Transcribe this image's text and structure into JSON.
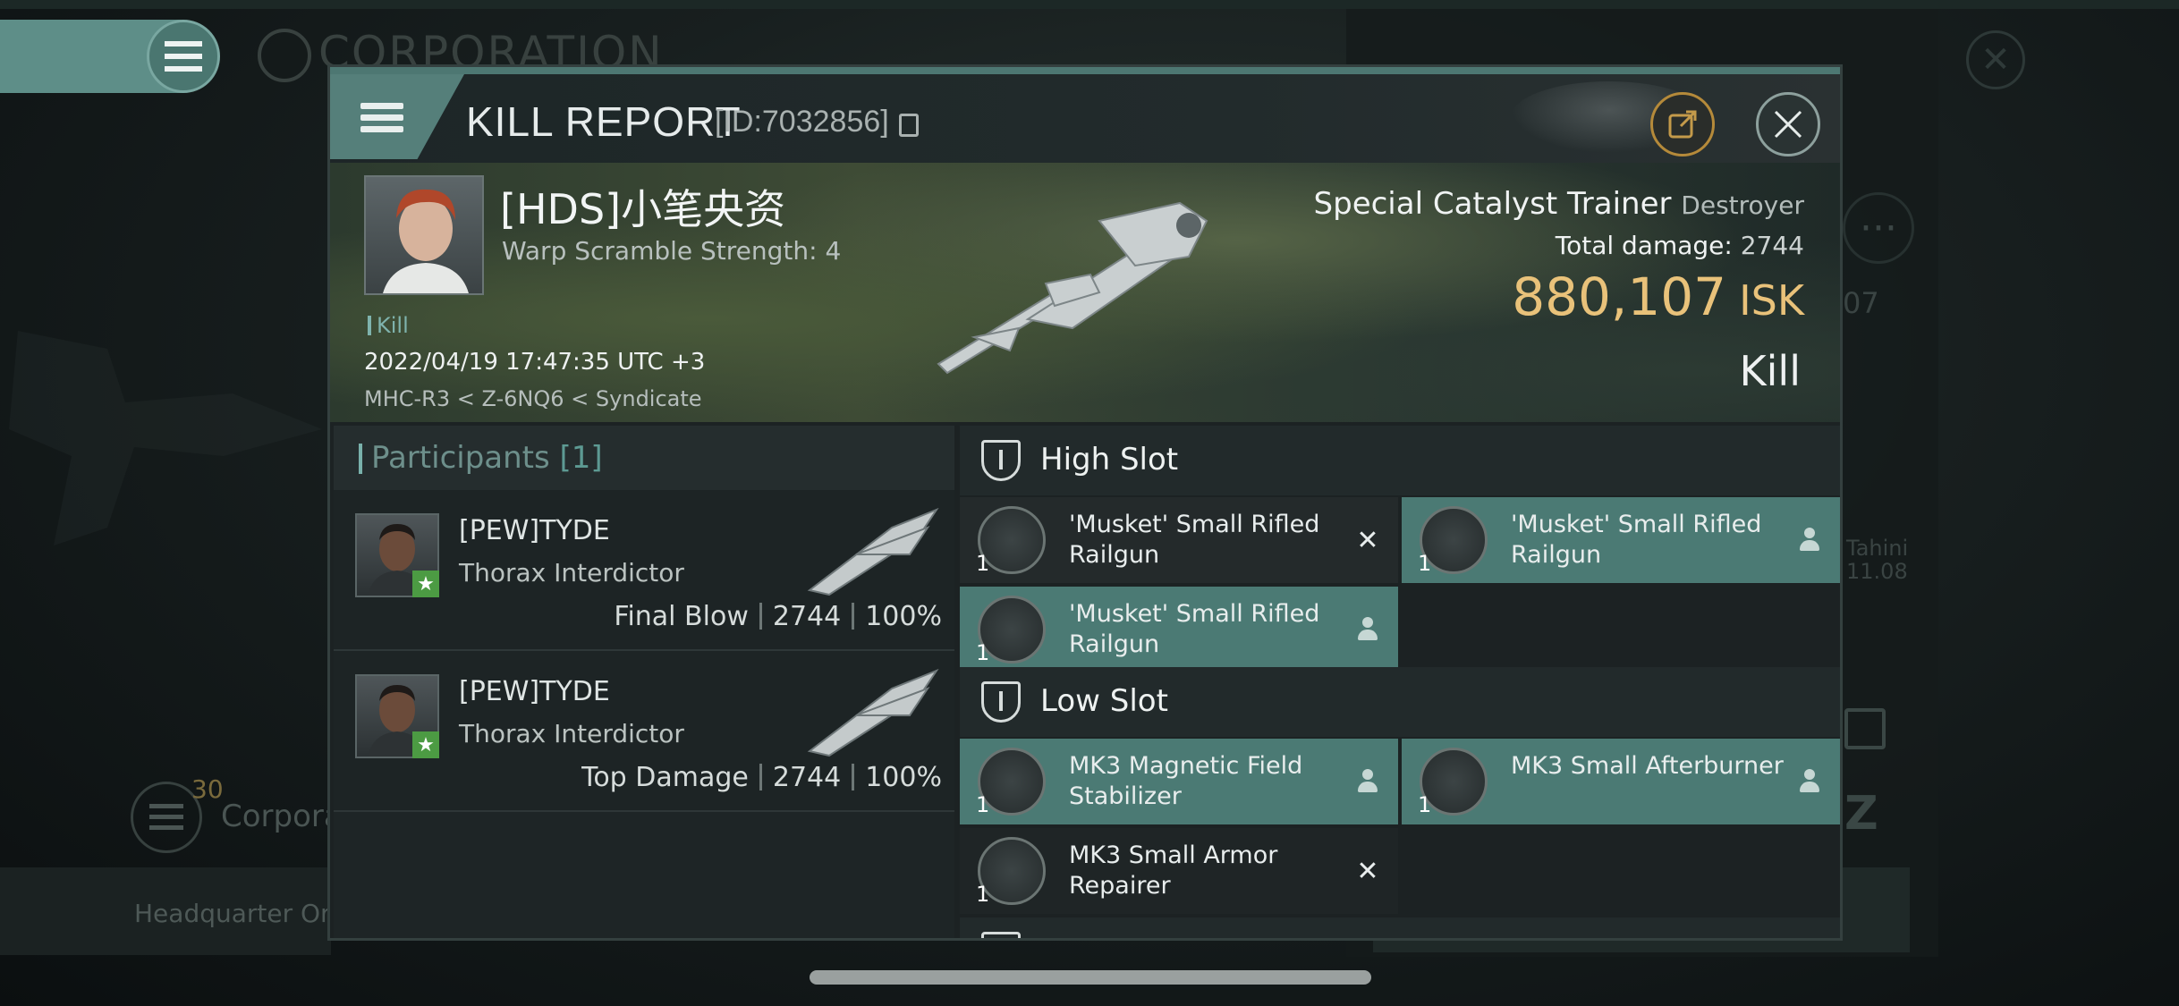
{
  "background": {
    "corp_title": "CORPORATION",
    "corp_button_count": "30",
    "corp_button_label": "Corpora",
    "hq_label": "Headquarter Orvc",
    "right_label_1": "Tahini",
    "right_label_2": "11.08",
    "right_number": "07",
    "dots": "···"
  },
  "header": {
    "title": "KILL REPORT",
    "report_id": "[ID:7032856]"
  },
  "victim": {
    "name": "[HDS]小笔央资",
    "subtitle": "Warp Scramble Strength: 4",
    "tag": "Kill",
    "datetime": "2022/04/19 17:47:35 UTC +3",
    "location": "MHC-R3 < Z-6NQ6 < Syndicate"
  },
  "ship": {
    "name": "Special Catalyst Trainer",
    "class": "Destroyer",
    "total_damage_label": "Total damage:",
    "total_damage_value": "2744",
    "isk_value": "880,107",
    "isk_unit": "ISK",
    "result": "Kill"
  },
  "participants": {
    "label": "Participants",
    "count": "[1]",
    "rows": [
      {
        "name": "[PEW]TYDE",
        "ship": "Thorax Interdictor",
        "role": "Final Blow",
        "damage": "2744",
        "percent": "100%"
      },
      {
        "name": "[PEW]TYDE",
        "ship": "Thorax Interdictor",
        "role": "Top Damage",
        "damage": "2744",
        "percent": "100%"
      }
    ]
  },
  "fittings": {
    "high_slot_label": "High Slot",
    "low_slot_label": "Low Slot",
    "high_modules": [
      {
        "qty": "1",
        "name": "'Musket' Small Rifled Railgun",
        "state": "destroyed"
      },
      {
        "qty": "1",
        "name": "'Musket' Small Rifled Railgun",
        "state": "dropped"
      },
      {
        "qty": "1",
        "name": "'Musket' Small Rifled Railgun",
        "state": "dropped"
      }
    ],
    "low_modules": [
      {
        "qty": "1",
        "name": "MK3 Magnetic Field Stabilizer",
        "state": "dropped"
      },
      {
        "qty": "1",
        "name": "MK3 Small Afterburner",
        "state": "dropped"
      },
      {
        "qty": "1",
        "name": "MK3 Small Armor Repairer",
        "state": "destroyed"
      }
    ]
  },
  "colors": {
    "accent_teal": "#4b7a74",
    "isk_gold": "#e9c27a",
    "share_ring": "#b58a3a",
    "final_blow_star": "#4c9b43"
  },
  "icons": {
    "menu": "hamburger-icon",
    "share": "share-icon",
    "close": "close-icon",
    "copy": "copy-icon",
    "slot": "slot-shield-icon",
    "dropped": "person-icon",
    "destroyed": "x-icon"
  }
}
